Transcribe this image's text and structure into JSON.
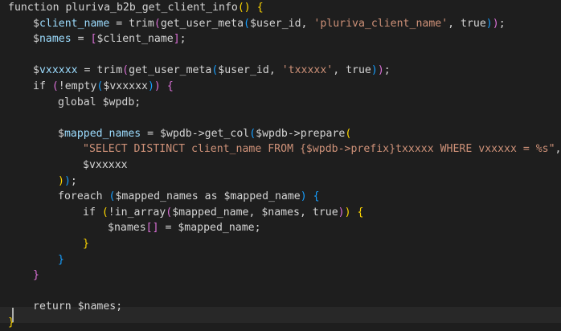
{
  "editor": {
    "language": "php",
    "colors": {
      "background": "#1e1e1e",
      "keyword": "#c586c0",
      "storage": "#569cd6",
      "function": "#dcdcaa",
      "variable": "#9cdcfe",
      "string": "#ce9178",
      "plain": "#d4d4d4",
      "bracket_1": "#ffd700",
      "bracket_2": "#da70d6",
      "bracket_3": "#179fff"
    },
    "lines": [
      {
        "indent": 0,
        "tokens": [
          {
            "t": "function ",
            "c": "plain"
          },
          {
            "t": "pluriva_b2b_get_client_info",
            "c": "plain"
          },
          {
            "t": "()",
            "c": "bracket_1"
          },
          {
            "t": " ",
            "c": "plain"
          },
          {
            "t": "{",
            "c": "bracket_1"
          }
        ]
      },
      {
        "indent": 1,
        "tokens": [
          {
            "t": "$",
            "c": "plain"
          },
          {
            "t": "client_name",
            "c": "variable"
          },
          {
            "t": " = trim",
            "c": "plain"
          },
          {
            "t": "(",
            "c": "bracket_2"
          },
          {
            "t": "get_user_meta",
            "c": "plain"
          },
          {
            "t": "(",
            "c": "bracket_3"
          },
          {
            "t": "$user_id, ",
            "c": "plain"
          },
          {
            "t": "'pluriva_client_name'",
            "c": "string"
          },
          {
            "t": ", true",
            "c": "plain"
          },
          {
            "t": ")",
            "c": "bracket_3"
          },
          {
            "t": ")",
            "c": "bracket_2"
          },
          {
            "t": ";",
            "c": "plain"
          }
        ]
      },
      {
        "indent": 1,
        "tokens": [
          {
            "t": "$",
            "c": "plain"
          },
          {
            "t": "names",
            "c": "variable"
          },
          {
            "t": " = ",
            "c": "plain"
          },
          {
            "t": "[",
            "c": "bracket_2"
          },
          {
            "t": "$client_name",
            "c": "plain"
          },
          {
            "t": "]",
            "c": "bracket_2"
          },
          {
            "t": ";",
            "c": "plain"
          }
        ]
      },
      {
        "indent": 0,
        "tokens": []
      },
      {
        "indent": 1,
        "tokens": [
          {
            "t": "$",
            "c": "plain"
          },
          {
            "t": "vxxxxx",
            "c": "variable"
          },
          {
            "t": " = trim",
            "c": "plain"
          },
          {
            "t": "(",
            "c": "bracket_2"
          },
          {
            "t": "get_user_meta",
            "c": "plain"
          },
          {
            "t": "(",
            "c": "bracket_3"
          },
          {
            "t": "$user_id, ",
            "c": "plain"
          },
          {
            "t": "'txxxxx'",
            "c": "string"
          },
          {
            "t": ", true",
            "c": "plain"
          },
          {
            "t": ")",
            "c": "bracket_3"
          },
          {
            "t": ")",
            "c": "bracket_2"
          },
          {
            "t": ";",
            "c": "plain"
          }
        ]
      },
      {
        "indent": 1,
        "tokens": [
          {
            "t": "if ",
            "c": "plain"
          },
          {
            "t": "(",
            "c": "bracket_2"
          },
          {
            "t": "!empty",
            "c": "plain"
          },
          {
            "t": "(",
            "c": "bracket_3"
          },
          {
            "t": "$vxxxxx",
            "c": "plain"
          },
          {
            "t": ")",
            "c": "bracket_3"
          },
          {
            "t": ")",
            "c": "bracket_2"
          },
          {
            "t": " ",
            "c": "plain"
          },
          {
            "t": "{",
            "c": "bracket_2"
          }
        ]
      },
      {
        "indent": 2,
        "tokens": [
          {
            "t": "global $wpdb;",
            "c": "plain"
          }
        ]
      },
      {
        "indent": 0,
        "tokens": []
      },
      {
        "indent": 2,
        "tokens": [
          {
            "t": "$",
            "c": "plain"
          },
          {
            "t": "mapped_names",
            "c": "variable"
          },
          {
            "t": " = $wpdb->get_col",
            "c": "plain"
          },
          {
            "t": "(",
            "c": "bracket_3"
          },
          {
            "t": "$wpdb->prepare",
            "c": "plain"
          },
          {
            "t": "(",
            "c": "bracket_1"
          }
        ]
      },
      {
        "indent": 3,
        "tokens": [
          {
            "t": "\"SELECT DISTINCT client_name FROM {$wpdb->prefix}txxxxx WHERE vxxxxx = %s\"",
            "c": "string"
          },
          {
            "t": ",",
            "c": "plain"
          }
        ]
      },
      {
        "indent": 3,
        "tokens": [
          {
            "t": "$vxxxxx",
            "c": "plain"
          }
        ]
      },
      {
        "indent": 2,
        "tokens": [
          {
            "t": ")",
            "c": "bracket_1"
          },
          {
            "t": ")",
            "c": "bracket_3"
          },
          {
            "t": ";",
            "c": "plain"
          }
        ]
      },
      {
        "indent": 2,
        "tokens": [
          {
            "t": "foreach ",
            "c": "plain"
          },
          {
            "t": "(",
            "c": "bracket_3"
          },
          {
            "t": "$mapped_names as $mapped_name",
            "c": "plain"
          },
          {
            "t": ")",
            "c": "bracket_3"
          },
          {
            "t": " ",
            "c": "plain"
          },
          {
            "t": "{",
            "c": "bracket_3"
          }
        ]
      },
      {
        "indent": 3,
        "tokens": [
          {
            "t": "if ",
            "c": "plain"
          },
          {
            "t": "(",
            "c": "bracket_1"
          },
          {
            "t": "!in_array",
            "c": "plain"
          },
          {
            "t": "(",
            "c": "bracket_2"
          },
          {
            "t": "$mapped_name, $names, true",
            "c": "plain"
          },
          {
            "t": ")",
            "c": "bracket_2"
          },
          {
            "t": ")",
            "c": "bracket_1"
          },
          {
            "t": " ",
            "c": "plain"
          },
          {
            "t": "{",
            "c": "bracket_1"
          }
        ]
      },
      {
        "indent": 4,
        "tokens": [
          {
            "t": "$names",
            "c": "plain"
          },
          {
            "t": "[]",
            "c": "bracket_2"
          },
          {
            "t": " = $mapped_name;",
            "c": "plain"
          }
        ]
      },
      {
        "indent": 3,
        "tokens": [
          {
            "t": "}",
            "c": "bracket_1"
          }
        ]
      },
      {
        "indent": 2,
        "tokens": [
          {
            "t": "}",
            "c": "bracket_3"
          }
        ]
      },
      {
        "indent": 1,
        "tokens": [
          {
            "t": "}",
            "c": "bracket_2"
          }
        ]
      },
      {
        "indent": 0,
        "tokens": []
      },
      {
        "indent": 1,
        "tokens": [
          {
            "t": "return $names;",
            "c": "plain"
          }
        ]
      },
      {
        "indent": 0,
        "tokens": [
          {
            "t": "}",
            "c": "bracket_1"
          }
        ]
      }
    ]
  }
}
